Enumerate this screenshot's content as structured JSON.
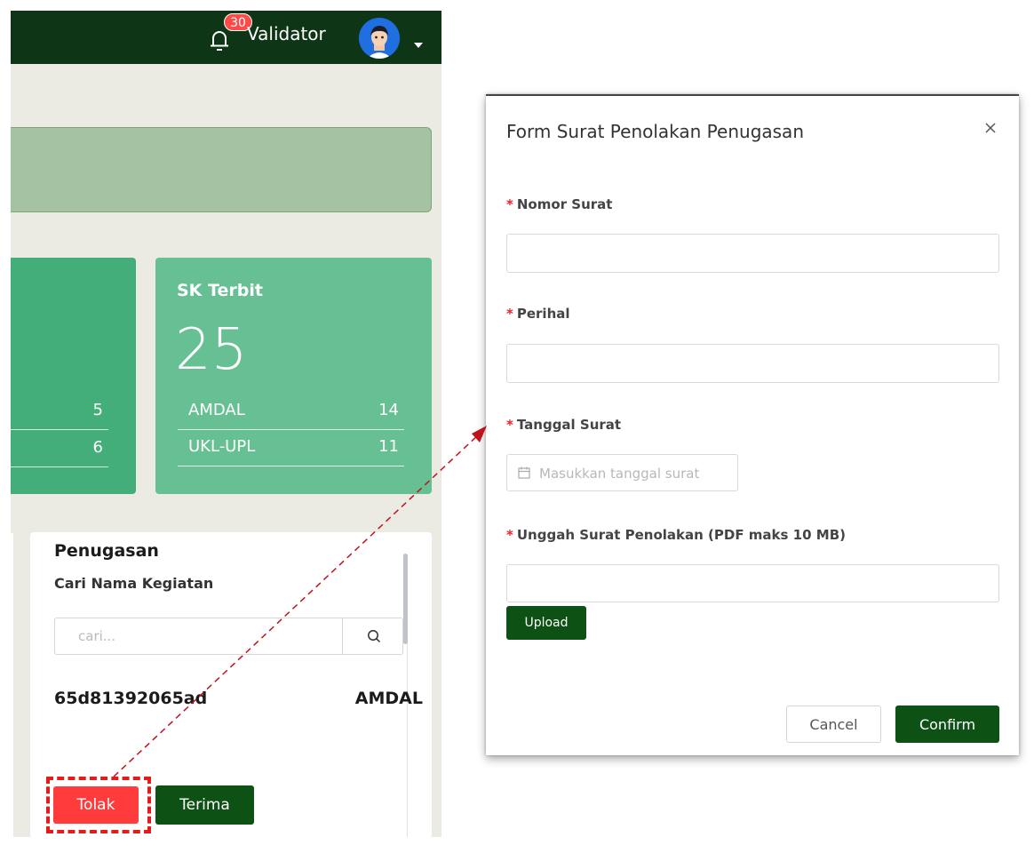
{
  "topbar": {
    "notification_count": "30",
    "username": "Validator",
    "icons": {
      "bell": "bell-icon",
      "avatar": "user-avatar",
      "caret": "caret-down-icon"
    },
    "colors": {
      "background": "#0e3516",
      "badge": "#ff4a4a"
    }
  },
  "stats": {
    "card1": {
      "rows": [
        {
          "value": "5"
        },
        {
          "value": "6"
        }
      ],
      "color": "#44ae7a"
    },
    "card2": {
      "title": "SK Terbit",
      "total": "25",
      "rows": [
        {
          "label": "AMDAL",
          "value": "14"
        },
        {
          "label": "UKL-UPL",
          "value": "11"
        }
      ],
      "color": "#67bf94"
    }
  },
  "penugasan": {
    "title": "Penugasan",
    "search_label": "Cari Nama Kegiatan",
    "search_placeholder": "cari...",
    "search_icon": "search-icon",
    "item": {
      "code": "65d81392065ad",
      "type": "AMDAL"
    },
    "reject_label": "Tolak",
    "accept_label": "Terima",
    "colors": {
      "reject": "#ff3b3b",
      "accept": "#0e5114",
      "highlight": "#e31b1b"
    }
  },
  "modal": {
    "title": "Form Surat Penolakan Penugasan",
    "close_icon": "close-icon",
    "required_mark": "*",
    "fields": {
      "nomor_surat": {
        "label": "Nomor Surat",
        "value": ""
      },
      "perihal": {
        "label": "Perihal",
        "value": ""
      },
      "tanggal_surat": {
        "label": "Tanggal Surat",
        "placeholder": "Masukkan tanggal surat",
        "icon": "calendar-icon"
      },
      "unggah": {
        "label": "Unggah Surat Penolakan (PDF maks 10 MB)",
        "value": ""
      }
    },
    "upload_label": "Upload",
    "cancel_label": "Cancel",
    "confirm_label": "Confirm",
    "colors": {
      "primary": "#0e5114",
      "required": "#e22222"
    }
  }
}
